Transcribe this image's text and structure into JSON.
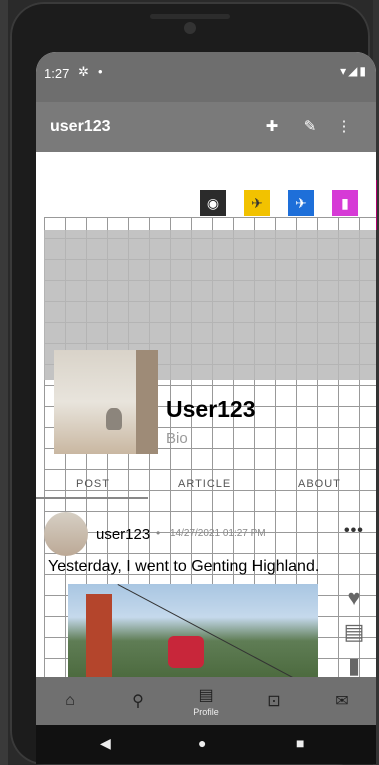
{
  "status": {
    "time": "1:27",
    "gear": "✲",
    "dot": "•",
    "icons": "▾◢▮"
  },
  "appbar": {
    "title": "user123",
    "add_icon": "✚",
    "edit_icon": "✎",
    "more_icon": "⋮"
  },
  "social": [
    {
      "name": "globe-icon",
      "glyph": "◉",
      "bg": "#2b2b2b",
      "fg": "#ffffff"
    },
    {
      "name": "plane-icon",
      "glyph": "✈",
      "bg": "#f2c200",
      "fg": "#333333"
    },
    {
      "name": "send-icon",
      "glyph": "✈",
      "bg": "#1e6fd9",
      "fg": "#ffffff"
    },
    {
      "name": "bookmark-icon",
      "glyph": "▮",
      "bg": "#d63ad6",
      "fg": "#ffffff"
    }
  ],
  "profile": {
    "name": "User123",
    "bio": "Bio"
  },
  "tabs": [
    "POST",
    "ARTICLE",
    "ABOUT"
  ],
  "post": {
    "user": "user123",
    "sep": "•",
    "time": "14/27/2021 01:27 PM",
    "more": "•••",
    "text": "Yesterday, I went to Genting Highland.",
    "actions": {
      "like": "♥",
      "comment": "▤",
      "share": "▮"
    }
  },
  "nav": {
    "home": "⌂",
    "search": "⚲",
    "profile_icon": "▤",
    "profile_label": "Profile",
    "camera": "⊡",
    "mail": "✉"
  },
  "sysnav": {
    "back": "◀",
    "home": "●",
    "recent": "■"
  }
}
